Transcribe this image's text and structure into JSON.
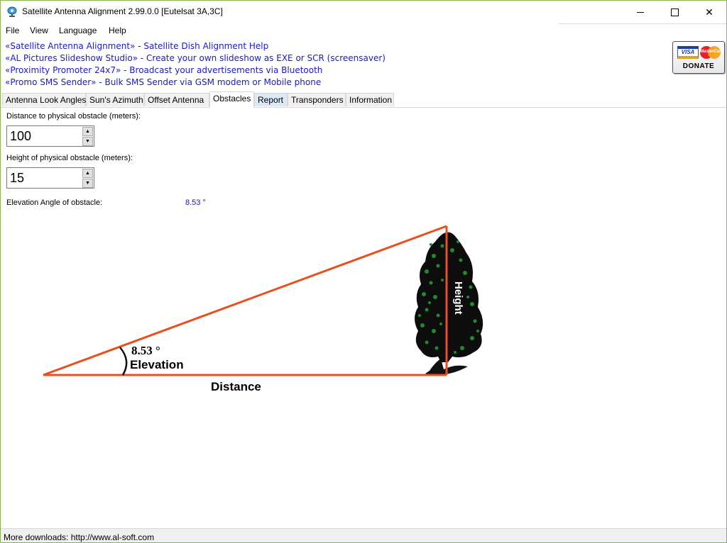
{
  "window": {
    "title": "Satellite Antenna Alignment 2.99.0.0 [Eutelsat 3A,3C]",
    "icon": "satellite-icon",
    "controls": {
      "minimize": "minimize-icon",
      "maximize": "maximize-icon",
      "close_label": "✕"
    }
  },
  "menu": {
    "items": [
      {
        "label": "File"
      },
      {
        "label": "View"
      },
      {
        "label": "Language"
      },
      {
        "label": "Help"
      }
    ]
  },
  "links": [
    {
      "text": "«Satellite Antenna Alignment» - Satellite Dish Alignment Help"
    },
    {
      "text": "«AL Pictures Slideshow Studio» - Create your own slideshow as EXE or SCR (screensaver)"
    },
    {
      "text": "«Proximity Promoter 24x7» - Broadcast your advertisements via Bluetooth"
    },
    {
      "text": "«Promo SMS Sender» - Bulk SMS Sender via GSM modem or Mobile phone"
    }
  ],
  "donate": {
    "label": "DONATE",
    "visa": "VISA",
    "mastercard": "MasterCard"
  },
  "tabs": [
    {
      "label": "Antenna Look Angles"
    },
    {
      "label": "Sun's Azimuth"
    },
    {
      "label": "Offset Antenna"
    },
    {
      "label": "Obstacles",
      "active": true
    },
    {
      "label": "Report"
    },
    {
      "label": "Transponders"
    },
    {
      "label": "Information"
    }
  ],
  "obstacles": {
    "distance_label": "Distance to physical obstacle (meters):",
    "distance_value": "100",
    "height_label": "Height of physical obstacle (meters):",
    "height_value": "15",
    "elevation_label": "Elevation Angle of obstacle:",
    "elevation_value": "8.53 °"
  },
  "diagram": {
    "angle_label": "8.53 °",
    "elevation_label": "Elevation",
    "distance_label": "Distance",
    "height_label": "Height",
    "line_color": "#e8501f",
    "tree_icon": "tree-icon"
  },
  "status": {
    "text": "More downloads: http://www.al-soft.com"
  },
  "colors": {
    "link": "#1a1ac8",
    "accent_border": "#8bb34f",
    "value": "#1a1a9a"
  }
}
